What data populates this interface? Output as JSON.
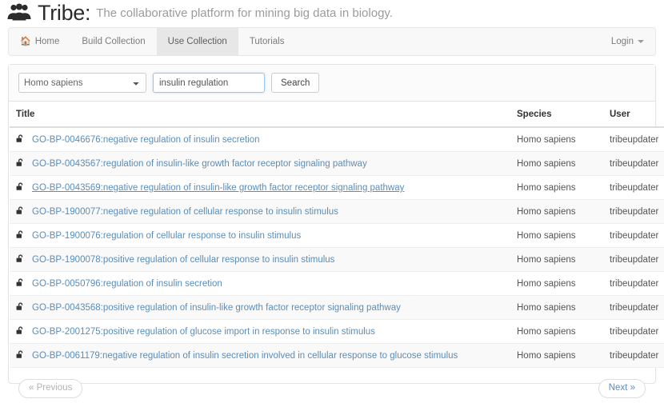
{
  "brand": {
    "icon": "users-group-icon",
    "name": "Tribe:",
    "tagline": "The collaborative platform for mining big data in biology."
  },
  "nav": {
    "items": [
      {
        "label": "Home",
        "icon": "home-icon",
        "active": false
      },
      {
        "label": "Build Collection",
        "icon": "",
        "active": false
      },
      {
        "label": "Use Collection",
        "icon": "",
        "active": true
      },
      {
        "label": "Tutorials",
        "icon": "",
        "active": false
      }
    ],
    "right": {
      "label": "Login",
      "icon": "caret-down-icon"
    }
  },
  "search": {
    "species_selected": "Homo sapiens",
    "species_options": [
      "Homo sapiens"
    ],
    "keyword_value": "insulin regulation",
    "keyword_placeholder": "",
    "search_label": "Search"
  },
  "table": {
    "columns": [
      "Title",
      "Species",
      "User"
    ],
    "rows": [
      {
        "icon": "unlock-icon",
        "title": "GO-BP-0046676:negative regulation of insulin secretion",
        "species": "Homo sapiens",
        "user": "tribeupdater",
        "hovered": false
      },
      {
        "icon": "unlock-icon",
        "title": "GO-BP-0043567:regulation of insulin-like growth factor receptor signaling pathway",
        "species": "Homo sapiens",
        "user": "tribeupdater",
        "hovered": false
      },
      {
        "icon": "unlock-icon",
        "title": "GO-BP-0043569:negative regulation of insulin-like growth factor receptor signaling pathway",
        "species": "Homo sapiens",
        "user": "tribeupdater",
        "hovered": true
      },
      {
        "icon": "unlock-icon",
        "title": "GO-BP-1900077:negative regulation of cellular response to insulin stimulus",
        "species": "Homo sapiens",
        "user": "tribeupdater",
        "hovered": false
      },
      {
        "icon": "unlock-icon",
        "title": "GO-BP-1900076:regulation of cellular response to insulin stimulus",
        "species": "Homo sapiens",
        "user": "tribeupdater",
        "hovered": false
      },
      {
        "icon": "unlock-icon",
        "title": "GO-BP-1900078:positive regulation of cellular response to insulin stimulus",
        "species": "Homo sapiens",
        "user": "tribeupdater",
        "hovered": false
      },
      {
        "icon": "unlock-icon",
        "title": "GO-BP-0050796:regulation of insulin secretion",
        "species": "Homo sapiens",
        "user": "tribeupdater",
        "hovered": false
      },
      {
        "icon": "unlock-icon",
        "title": "GO-BP-0043568:positive regulation of insulin-like growth factor receptor signaling pathway",
        "species": "Homo sapiens",
        "user": "tribeupdater",
        "hovered": false
      },
      {
        "icon": "unlock-icon",
        "title": "GO-BP-2001275:positive regulation of glucose import in response to insulin stimulus",
        "species": "Homo sapiens",
        "user": "tribeupdater",
        "hovered": false
      },
      {
        "icon": "unlock-icon",
        "title": "GO-BP-0061179:negative regulation of insulin secretion involved in cellular response to glucose stimulus",
        "species": "Homo sapiens",
        "user": "tribeupdater",
        "hovered": false
      }
    ]
  },
  "pagination": {
    "previous_label": "« Previous",
    "previous_disabled": true,
    "next_label": "Next »"
  },
  "colors": {
    "link": "#5b8db8",
    "nav_active_bg": "#e7e7e7",
    "focus_border": "#9ec5e8",
    "tagline": "#9b9b9b"
  }
}
